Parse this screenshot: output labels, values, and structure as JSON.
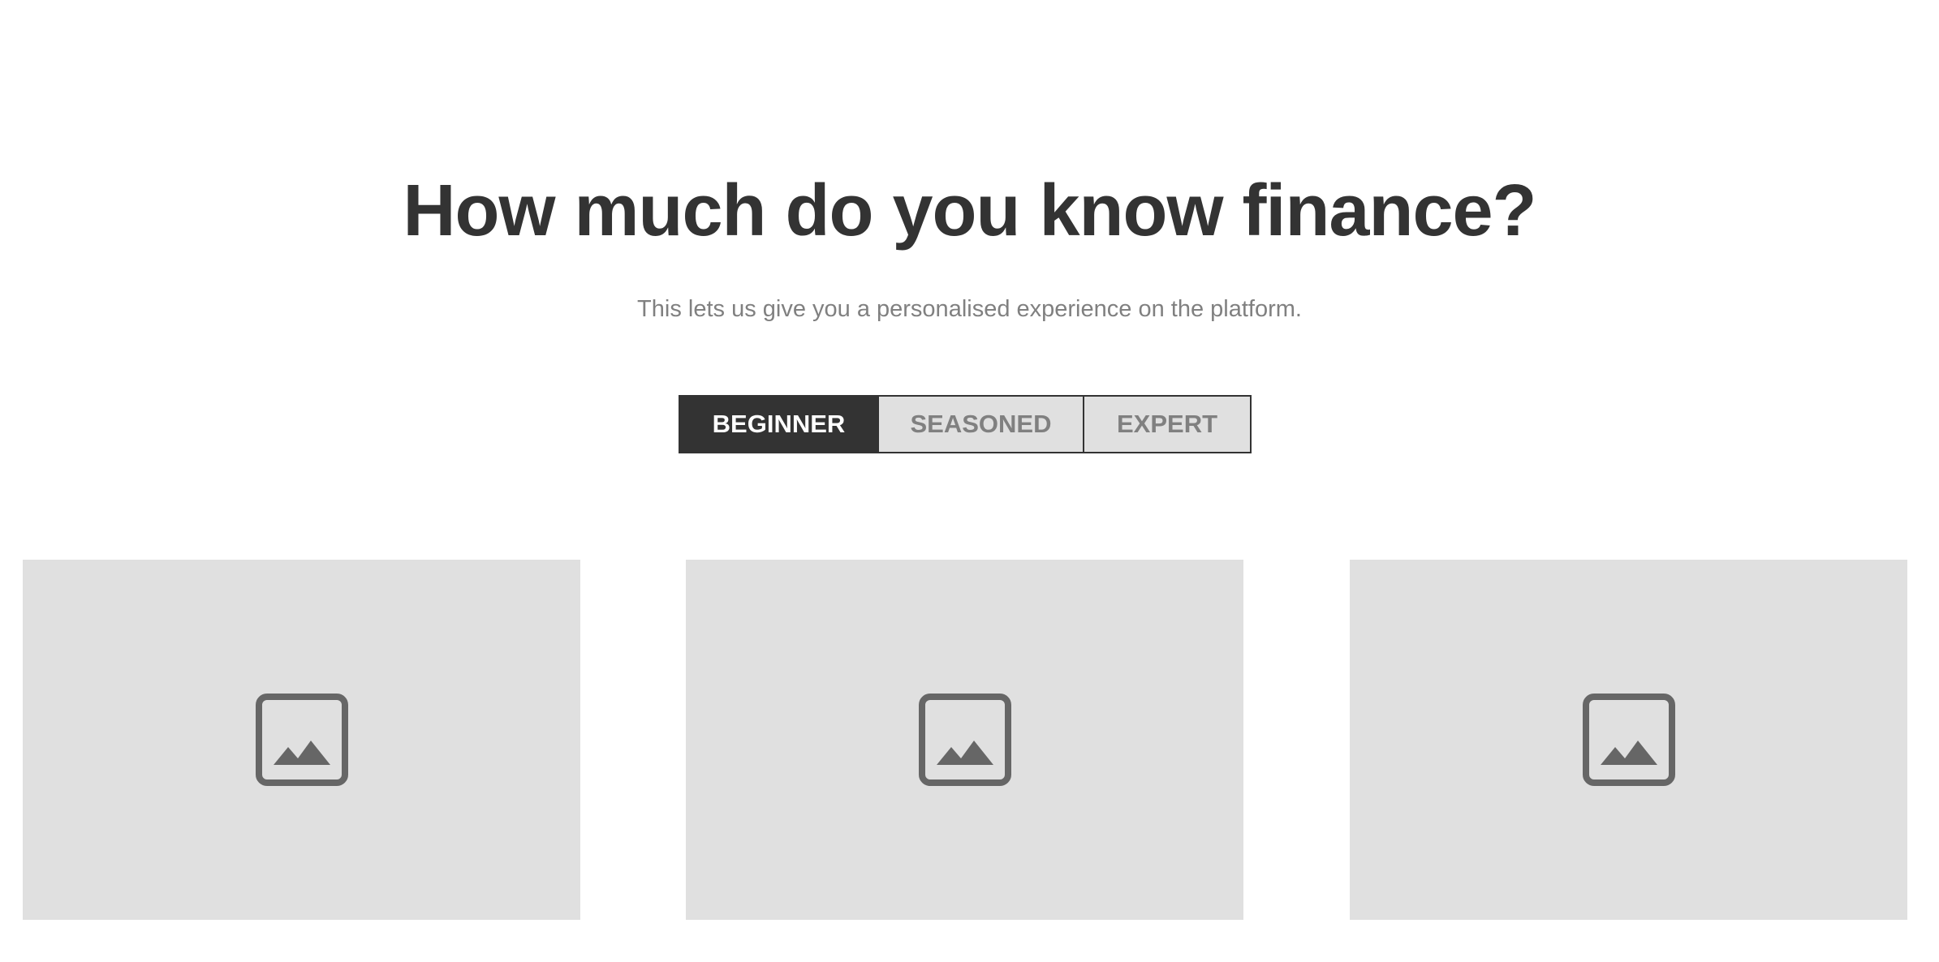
{
  "header": {
    "title": "How much do you know finance?",
    "subtitle": "This lets us give you a personalised experience on the platform."
  },
  "levels": {
    "selected": "BEGINNER",
    "options": [
      {
        "label": "BEGINNER",
        "active": true
      },
      {
        "label": "SEASONED",
        "active": false
      },
      {
        "label": "EXPERT",
        "active": false
      }
    ]
  },
  "cards": [
    {
      "icon": "image-placeholder-icon"
    },
    {
      "icon": "image-placeholder-icon"
    },
    {
      "icon": "image-placeholder-icon"
    }
  ],
  "colors": {
    "dark": "#333333",
    "muted_text": "#808080",
    "placeholder_bg": "#e0e0e0",
    "icon": "#666666"
  }
}
